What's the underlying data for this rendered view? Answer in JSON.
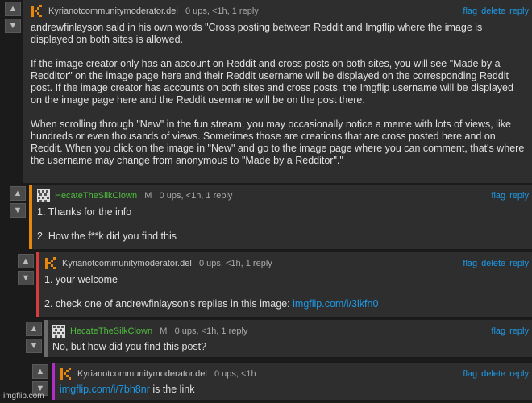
{
  "vote_up_icon": "arrow-up",
  "vote_down_icon": "arrow-down",
  "colors": {
    "link": "#1e9ae6",
    "green_name": "#4fbf3d",
    "bar_orange": "#e8870e",
    "bar_red": "#d83b3b",
    "bar_grey": "#6c6c6c",
    "bar_magenta": "#b02dc7"
  },
  "comments": [
    {
      "author": "Kyrianotcommunitymoderator.del",
      "meta": "0 ups, <1h, 1 reply",
      "actions": [
        "flag",
        "delete",
        "reply"
      ],
      "paragraphs": [
        "andrewfinlayson said in his own words \"Cross posting between Reddit and Imgflip where the image is displayed on both sites is allowed.",
        "If the image creator only has an account on Reddit and cross posts on both sites, you will see \"Made by a Redditor\" on the image page here and their Reddit username will be displayed on the corresponding Reddit post. If the image creator has accounts on both sites and cross posts, the Imgflip username will be displayed on the image page here and the Reddit username will be on the post there.",
        "When scrolling through \"New\" in the fun stream, you may occasionally notice a meme with lots of views, like hundreds or even thousands of views. Sometimes those are creations that are cross posted here and on Reddit. When you click on the image in \"New\" and go to the image page where you can comment, that's where the username may change from anonymous to \"Made by a Redditor\".\""
      ]
    },
    {
      "author": "HecateTheSilkClown",
      "badge": "M",
      "meta": "0 ups, <1h, 1 reply",
      "actions": [
        "flag",
        "reply"
      ],
      "line1": "1. Thanks for the info",
      "line2": "2. How the f**k did you find this"
    },
    {
      "author": "Kyrianotcommunitymoderator.del",
      "meta": "0 ups, <1h, 1 reply",
      "actions": [
        "flag",
        "delete",
        "reply"
      ],
      "line1": "1. your welcome",
      "line2": "2. check one of andrewfinlayson's replies in this image:",
      "link": "imgflip.com/i/3lkfn0"
    },
    {
      "author": "HecateTheSilkClown",
      "badge": "M",
      "meta": "0 ups, <1h, 1 reply",
      "actions": [
        "flag",
        "reply"
      ],
      "line1": "No, but how did you find this post?"
    },
    {
      "author": "Kyrianotcommunitymoderator.del",
      "meta": "0 ups, <1h",
      "actions": [
        "flag",
        "delete",
        "reply"
      ],
      "link": "imgflip.com/i/7bh8nr",
      "line_after_link": " is the link"
    }
  ],
  "watermark": "imgflip.com"
}
